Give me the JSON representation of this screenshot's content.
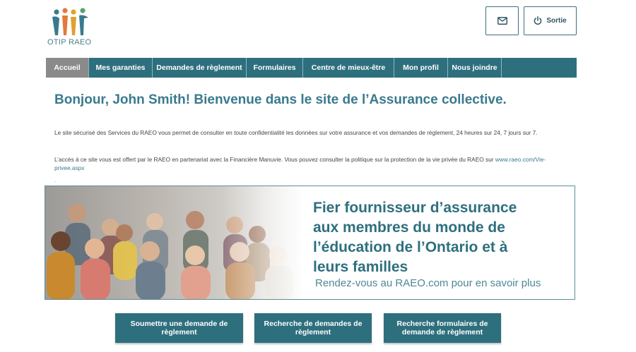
{
  "logo": {
    "text": "OTIP RAEO",
    "mark": "·",
    "icon": "people-figures-logo"
  },
  "header": {
    "mail_icon": "envelope-icon",
    "exit_icon": "power-icon",
    "exit_label": "Sortie"
  },
  "nav": {
    "items": [
      {
        "label": "Accueil",
        "active": true
      },
      {
        "label": "Mes garanties",
        "active": false
      },
      {
        "label": "Demandes de règlement",
        "active": false
      },
      {
        "label": "Formulaires",
        "active": false
      },
      {
        "label": "Centre de mieux-être",
        "active": false
      },
      {
        "label": "Mon profil",
        "active": false
      },
      {
        "label": "Nous joindre",
        "active": false
      },
      {
        "label": "",
        "active": false
      }
    ]
  },
  "main": {
    "headline": "Bonjour, John Smith! Bienvenue dans le site de l’Assurance collective.",
    "para1": "Le site sécurisé des Services du RAEO vous permet de consulter en toute confidentialité les données sur votre assurance et vos demandes de règlement, 24 heures sur 24, 7 jours sur 7.",
    "para2_text": "L’accès à ce site vous est offert par le RAEO en partenariat avec la Financière Manuvie. Vous pouvez consulter la politique sur la protection de la vie privée du RAEO sur ",
    "para2_link": "www.raeo.com/Vie-privee.aspx",
    "dot": "."
  },
  "banner": {
    "title_lines": [
      "Fier fournisseur d’assurance",
      "aux membres du monde de",
      "l’éducation de l’Ontario et à",
      "leurs familles"
    ],
    "subtitle": "Rendez-vous au RAEO.com pour en savoir plus"
  },
  "actions": {
    "submit": "Soumettre une demande de règlement",
    "search_claims": "Recherche de demandes de règlement",
    "search_forms": "Recherche formulaires de demande de règlement"
  },
  "colors": {
    "primary": "#2e6f7e",
    "nav_active": "#8a8a8a",
    "headline": "#3a7a8e"
  }
}
